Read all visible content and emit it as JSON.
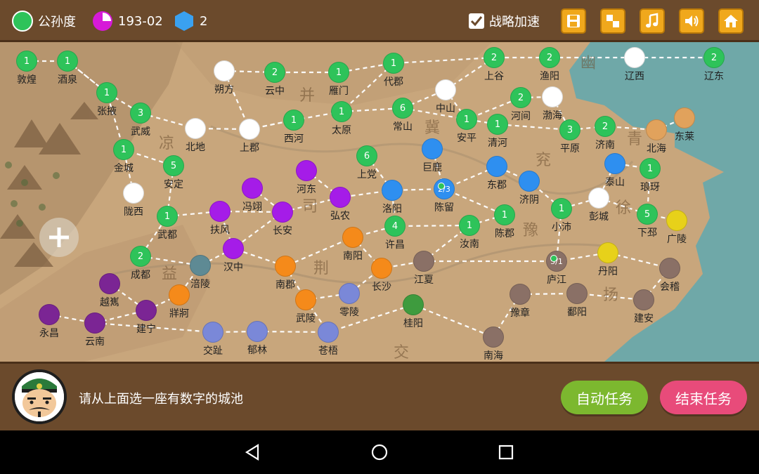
{
  "status": {
    "faction_name": "公孙度",
    "faction_color": "#2ec35a",
    "date": "193-02",
    "date_icon_color": "#d61ad8",
    "gem_count": "2",
    "gem_color": "#3aa1f0"
  },
  "toolbar": {
    "strategy_speedup_label": "战略加速",
    "strategy_speedup_checked": true,
    "buttons": [
      "save-icon",
      "layout-icon",
      "music-icon",
      "volume-icon",
      "home-icon"
    ]
  },
  "colors": {
    "green": "#2ec35a",
    "white": "#ffffff",
    "purple": "#a51ce8",
    "blue": "#2e8ff0",
    "orange": "#f58a1a",
    "tan": "#e1a25c",
    "gray": "#8a7066",
    "dark_purple": "#7b2594",
    "periwinkle": "#7a88d8",
    "teal_gray": "#5e8a94",
    "yellow": "#e7d11a",
    "dark_green": "#3e9b3e",
    "sea": "#6fa8a8"
  },
  "regions": [
    "幽",
    "并",
    "凉",
    "冀",
    "青",
    "兖",
    "司",
    "徐",
    "豫",
    "益",
    "荆",
    "扬",
    "交"
  ],
  "cities": [
    {
      "name": "敦煌",
      "color": "green",
      "num": "1"
    },
    {
      "name": "酒泉",
      "color": "green",
      "num": "1"
    },
    {
      "name": "朔方",
      "color": "white",
      "num": ""
    },
    {
      "name": "云中",
      "color": "green",
      "num": "2"
    },
    {
      "name": "雁门",
      "color": "green",
      "num": "1"
    },
    {
      "name": "代郡",
      "color": "green",
      "num": "1"
    },
    {
      "name": "上谷",
      "color": "green",
      "num": "2"
    },
    {
      "name": "渔阳",
      "color": "green",
      "num": "2"
    },
    {
      "name": "辽西",
      "color": "white",
      "num": ""
    },
    {
      "name": "辽东",
      "color": "green",
      "num": "2"
    },
    {
      "name": "张掖",
      "color": "green",
      "num": "1"
    },
    {
      "name": "武威",
      "color": "green",
      "num": "3"
    },
    {
      "name": "北地",
      "color": "white",
      "num": ""
    },
    {
      "name": "上郡",
      "color": "white",
      "num": ""
    },
    {
      "name": "西河",
      "color": "green",
      "num": "1"
    },
    {
      "name": "太原",
      "color": "green",
      "num": "1"
    },
    {
      "name": "常山",
      "color": "green",
      "num": "6"
    },
    {
      "name": "中山",
      "color": "white",
      "num": ""
    },
    {
      "name": "河间",
      "color": "green",
      "num": "2"
    },
    {
      "name": "渤海",
      "color": "white",
      "num": ""
    },
    {
      "name": "安平",
      "color": "green",
      "num": "1"
    },
    {
      "name": "清河",
      "color": "green",
      "num": "1"
    },
    {
      "name": "平原",
      "color": "green",
      "num": "3"
    },
    {
      "name": "济南",
      "color": "green",
      "num": "2"
    },
    {
      "name": "北海",
      "color": "tan",
      "num": ""
    },
    {
      "name": "东莱",
      "color": "tan",
      "num": ""
    },
    {
      "name": "金城",
      "color": "green",
      "num": "1"
    },
    {
      "name": "安定",
      "color": "green",
      "num": "5"
    },
    {
      "name": "上党",
      "color": "green",
      "num": "6"
    },
    {
      "name": "巨鹿",
      "color": "blue",
      "num": ""
    },
    {
      "name": "东郡",
      "color": "blue",
      "num": ""
    },
    {
      "name": "泰山",
      "color": "blue",
      "num": ""
    },
    {
      "name": "琅玡",
      "color": "green",
      "num": "1"
    },
    {
      "name": "陇西",
      "color": "white",
      "num": ""
    },
    {
      "name": "河东",
      "color": "purple",
      "num": ""
    },
    {
      "name": "冯翊",
      "color": "purple",
      "num": ""
    },
    {
      "name": "弘农",
      "color": "purple",
      "num": ""
    },
    {
      "name": "洛阳",
      "color": "blue",
      "num": ""
    },
    {
      "name": "陈留",
      "color": "blue",
      "num": "2/3"
    },
    {
      "name": "济阴",
      "color": "blue",
      "num": ""
    },
    {
      "name": "彭城",
      "color": "white",
      "num": ""
    },
    {
      "name": "下邳",
      "color": "green",
      "num": "5"
    },
    {
      "name": "广陵",
      "color": "yellow",
      "num": ""
    },
    {
      "name": "武都",
      "color": "green",
      "num": "1"
    },
    {
      "name": "扶风",
      "color": "purple",
      "num": ""
    },
    {
      "name": "长安",
      "color": "purple",
      "num": ""
    },
    {
      "name": "许昌",
      "color": "green",
      "num": "4"
    },
    {
      "name": "汝南",
      "color": "green",
      "num": "1"
    },
    {
      "name": "陈郡",
      "color": "green",
      "num": "1"
    },
    {
      "name": "小沛",
      "color": "green",
      "num": "1"
    },
    {
      "name": "成都",
      "color": "green",
      "num": "2"
    },
    {
      "name": "汉中",
      "color": "purple",
      "num": ""
    },
    {
      "name": "南阳",
      "color": "orange",
      "num": ""
    },
    {
      "name": "涪陵",
      "color": "teal_gray",
      "num": ""
    },
    {
      "name": "南郡",
      "color": "orange",
      "num": ""
    },
    {
      "name": "长沙",
      "color": "orange",
      "num": ""
    },
    {
      "name": "江夏",
      "color": "gray",
      "num": ""
    },
    {
      "name": "庐江",
      "color": "gray",
      "num": "5/1"
    },
    {
      "name": "丹阳",
      "color": "yellow",
      "num": ""
    },
    {
      "name": "会稽",
      "color": "gray",
      "num": ""
    },
    {
      "name": "越嶲",
      "color": "dark_purple",
      "num": ""
    },
    {
      "name": "牂牁",
      "color": "orange",
      "num": ""
    },
    {
      "name": "零陵",
      "color": "periwinkle",
      "num": ""
    },
    {
      "name": "武陵",
      "color": "orange",
      "num": ""
    },
    {
      "name": "桂阳",
      "color": "dark_green",
      "num": ""
    },
    {
      "name": "豫章",
      "color": "gray",
      "num": ""
    },
    {
      "name": "鄱阳",
      "color": "gray",
      "num": ""
    },
    {
      "name": "建安",
      "color": "gray",
      "num": ""
    },
    {
      "name": "永昌",
      "color": "dark_purple",
      "num": ""
    },
    {
      "name": "建宁",
      "color": "dark_purple",
      "num": ""
    },
    {
      "name": "云南",
      "color": "dark_purple",
      "num": ""
    },
    {
      "name": "交趾",
      "color": "periwinkle",
      "num": ""
    },
    {
      "name": "郁林",
      "color": "periwinkle",
      "num": ""
    },
    {
      "name": "苍梧",
      "color": "periwinkle",
      "num": ""
    },
    {
      "name": "南海",
      "color": "gray",
      "num": ""
    }
  ],
  "bottom": {
    "prompt": "请从上面选一座有数字的城池",
    "auto_task_label": "自动任务",
    "auto_task_color": "#7cb82f",
    "end_task_label": "结束任务",
    "end_task_color": "#e84b7a"
  },
  "nav": [
    "back-icon",
    "home-circle-icon",
    "recents-icon"
  ]
}
